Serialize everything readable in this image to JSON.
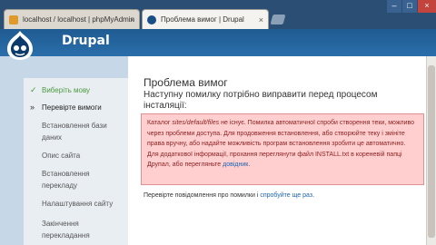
{
  "browser": {
    "tabs": [
      {
        "title": "localhost / localhost | phpMyAdmin",
        "close": "×"
      },
      {
        "title": "Проблема вимог | Drupal",
        "close": "×"
      }
    ],
    "window_controls": {
      "minimize": "–",
      "maximize": "□",
      "close": "×"
    }
  },
  "header": {
    "site_name": "Drupal"
  },
  "sidebar": {
    "steps": [
      {
        "label": "Виберіть мову",
        "state": "done",
        "mark": "✓"
      },
      {
        "label": "Перевірте вимоги",
        "state": "active",
        "mark": "»"
      },
      {
        "label": "Встановлення бази даних",
        "state": "pending"
      },
      {
        "label": "Опис сайта",
        "state": "pending"
      },
      {
        "label": "Встановлення перекладу",
        "state": "pending"
      },
      {
        "label": "Налаштування сайту",
        "state": "pending"
      },
      {
        "label": "Закінчення перекладання",
        "state": "pending"
      }
    ]
  },
  "main": {
    "title": "Проблема вимог",
    "subtitle": "Наступну помилку потрібно виправити перед процесом інсталяції:",
    "error": {
      "path": "sites/default/files",
      "text_before": "Каталог ",
      "text_after": " не існує. Помилка автоматичної спроби створення теки, можливо через проблеми доступа. Для продовження встановлення, або створюйте теку і змініте права вручну, або надайте можливість програм встановлення зробити це автоматично. Для додаткової інформації, прохання переглянути файл INSTALL.txt в кореневій папці Друпал, або перегляньте ",
      "link": "довідник",
      "text_end": "."
    },
    "footer": {
      "text": "Перевірте повідомлення про помилки і ",
      "link": "спробуйте ще раз",
      "end": "."
    }
  },
  "colors": {
    "header_blue": "#1f5b91",
    "error_bg": "#ffcfcf",
    "link": "#1e63b0",
    "done_green": "#4a9a3c"
  }
}
